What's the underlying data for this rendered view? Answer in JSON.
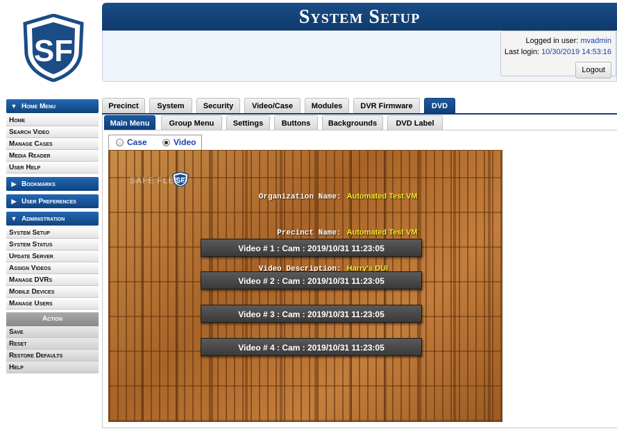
{
  "header": {
    "title": "System Setup",
    "logged_in_label": "Logged in user:",
    "logged_in_user": "mvadmin",
    "last_login_label": "Last login:",
    "last_login": "10/30/2019 14:53:16",
    "logout_label": "Logout"
  },
  "sidebar": {
    "home_menu": "Home Menu",
    "home_items": [
      "Home",
      "Search Video",
      "Manage Cases",
      "Media Reader",
      "User Help"
    ],
    "bookmarks": "Bookmarks",
    "user_preferences": "User Preferences",
    "administration": "Administration",
    "admin_items": [
      "System Setup",
      "System Status",
      "Update Server",
      "Assign Videos",
      "Manage DVRs",
      "Mobile Devices",
      "Manage Users"
    ],
    "action": "Action",
    "action_items": [
      "Save",
      "Reset",
      "Restore Defaults",
      "Help"
    ]
  },
  "tabs_main": [
    "Precinct",
    "System",
    "Security",
    "Video/Case",
    "Modules",
    "DVR Firmware",
    "DVD"
  ],
  "tabs_main_active": "DVD",
  "tabs_sub": [
    "Main Menu",
    "Group Menu",
    "Settings",
    "Buttons",
    "Backgrounds",
    "DVD Label"
  ],
  "tabs_sub_active": "Main Menu",
  "selector": {
    "case_label": "Case",
    "video_label": "Video",
    "selected": "Video"
  },
  "preview": {
    "logo_text": "SAFE FLEET",
    "org_label": "Organization Name:",
    "org_value": "Automated Test VM",
    "precinct_label": "Precinct Name:",
    "precinct_value": "Automated Test VM",
    "desc_label": "Video Description:",
    "desc_value": "Harry's DUI",
    "videos": [
      "Video # 1 : Cam : 2019/10/31 11:23:05",
      "Video # 2 : Cam : 2019/10/31 11:23:05",
      "Video # 3 : Cam : 2019/10/31 11:23:05",
      "Video # 4 : Cam : 2019/10/31 11:23:05"
    ]
  },
  "colors": {
    "brand_blue": "#0e3a6c",
    "link_blue": "#1f3fa6",
    "preview_value_yellow": "#f2ef2a"
  }
}
